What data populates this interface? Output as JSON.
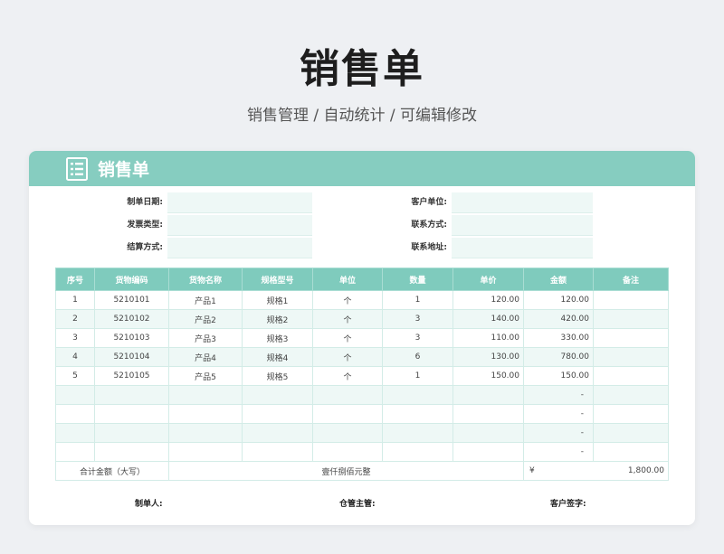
{
  "page": {
    "title": "销售单",
    "subtitle": "销售管理 / 自动统计 /  可编辑修改"
  },
  "card": {
    "title": "销售单",
    "icon": "document-list-icon"
  },
  "info": {
    "order_date_label": "制单日期:",
    "invoice_type_label": "发票类型:",
    "settlement_label": "结算方式:",
    "customer_label": "客户单位:",
    "contact_label": "联系方式:",
    "address_label": "联系地址:",
    "order_date_value": "",
    "invoice_type_value": "",
    "settlement_value": "",
    "customer_value": "",
    "contact_value": "",
    "address_value": ""
  },
  "table": {
    "headers": [
      "序号",
      "货物编码",
      "货物名称",
      "规格型号",
      "单位",
      "数量",
      "单价",
      "金额",
      "备注"
    ],
    "rows": [
      [
        "1",
        "5210101",
        "产品1",
        "规格1",
        "个",
        "1",
        "120.00",
        "120.00",
        ""
      ],
      [
        "2",
        "5210102",
        "产品2",
        "规格2",
        "个",
        "3",
        "140.00",
        "420.00",
        ""
      ],
      [
        "3",
        "5210103",
        "产品3",
        "规格3",
        "个",
        "3",
        "110.00",
        "330.00",
        ""
      ],
      [
        "4",
        "5210104",
        "产品4",
        "规格4",
        "个",
        "6",
        "130.00",
        "780.00",
        ""
      ],
      [
        "5",
        "5210105",
        "产品5",
        "规格5",
        "个",
        "1",
        "150.00",
        "150.00",
        ""
      ],
      [
        "",
        "",
        "",
        "",
        "",
        "",
        "",
        "-",
        ""
      ],
      [
        "",
        "",
        "",
        "",
        "",
        "",
        "",
        "-",
        ""
      ],
      [
        "",
        "",
        "",
        "",
        "",
        "",
        "",
        "-",
        ""
      ],
      [
        "",
        "",
        "",
        "",
        "",
        "",
        "",
        "-",
        ""
      ]
    ],
    "total_label": "合计金额（大写）",
    "total_words": "壹仟捌佰元整",
    "currency_symbol": "¥",
    "total_amount": "1,800.00"
  },
  "signatures": {
    "maker": "制单人:",
    "warehouse": "仓管主管:",
    "customer": "客户签字:"
  },
  "colors": {
    "accent": "#86cdc0",
    "header_row": "#7fcbbd",
    "row_alt": "#eef8f6"
  }
}
